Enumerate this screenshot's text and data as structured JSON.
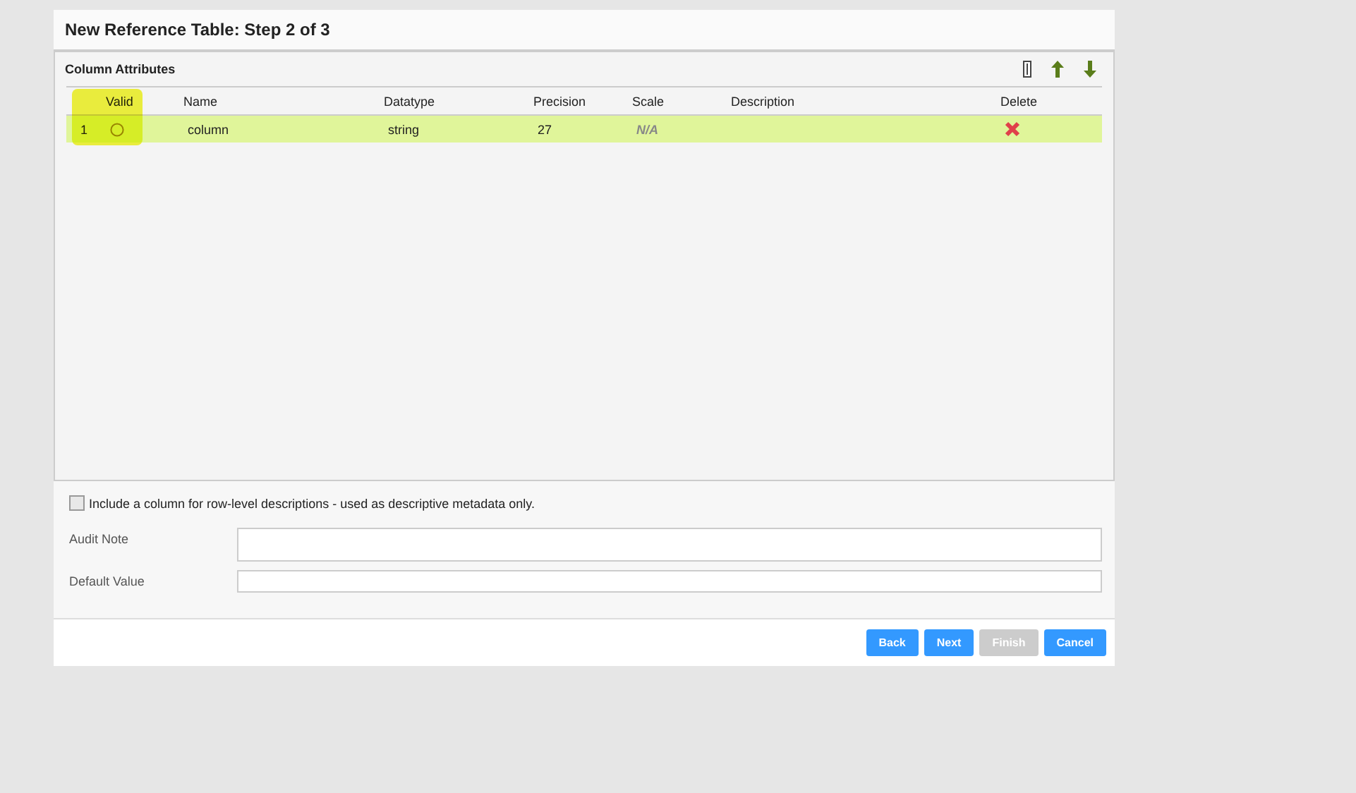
{
  "dialog": {
    "title": "New Reference Table: Step 2 of 3"
  },
  "panel": {
    "title": "Column Attributes"
  },
  "table": {
    "columns": [
      "Valid",
      "Name",
      "Datatype",
      "Precision",
      "Scale",
      "Description",
      "Delete"
    ],
    "rows": [
      {
        "index": "1",
        "name": "column",
        "datatype": "string",
        "precision": "27",
        "scale": "N/A",
        "selected": true
      }
    ]
  },
  "description_option": {
    "label": "Include a column for row-level descriptions - used as descriptive metadata only.",
    "checked": false
  },
  "fields": [
    {
      "label": "Audit Note",
      "kind": "textarea"
    },
    {
      "label": "Default Value",
      "kind": "input"
    }
  ],
  "buttons": [
    {
      "label": "Back",
      "disabled": false
    },
    {
      "label": "Next",
      "disabled": false
    },
    {
      "label": "Finish",
      "disabled": true
    },
    {
      "label": "Cancel",
      "disabled": false
    }
  ]
}
